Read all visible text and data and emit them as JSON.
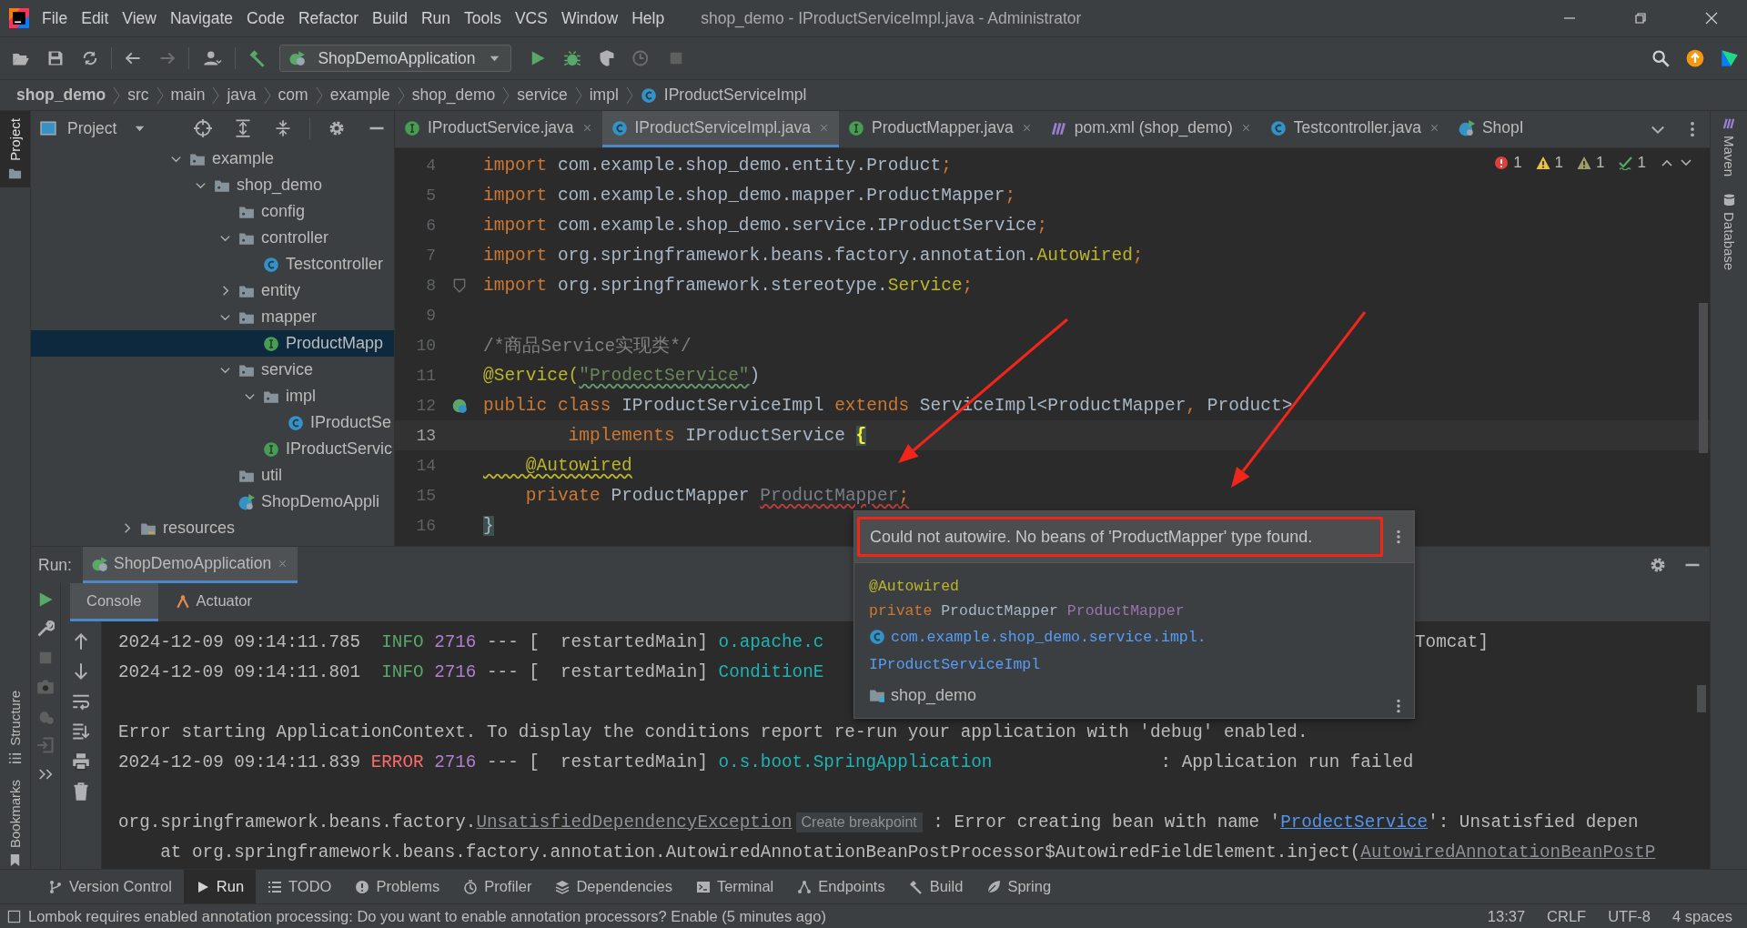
{
  "window": {
    "title": "shop_demo - IProductServiceImpl.java - Administrator"
  },
  "menu": [
    "File",
    "Edit",
    "View",
    "Navigate",
    "Code",
    "Refactor",
    "Build",
    "Run",
    "Tools",
    "VCS",
    "Window",
    "Help"
  ],
  "toolbar": {
    "run_config": "ShopDemoApplication"
  },
  "breadcrumbs": [
    {
      "label": "shop_demo",
      "kind": "project"
    },
    {
      "label": "src",
      "kind": "dir"
    },
    {
      "label": "main",
      "kind": "dir"
    },
    {
      "label": "java",
      "kind": "dir"
    },
    {
      "label": "com",
      "kind": "dir"
    },
    {
      "label": "example",
      "kind": "dir"
    },
    {
      "label": "shop_demo",
      "kind": "dir"
    },
    {
      "label": "service",
      "kind": "dir"
    },
    {
      "label": "impl",
      "kind": "dir"
    },
    {
      "label": "IProductServiceImpl",
      "kind": "class"
    }
  ],
  "left_strip": [
    {
      "label": "Project",
      "selected": true
    },
    {
      "label": "Structure",
      "selected": false
    },
    {
      "label": "Bookmarks",
      "selected": false
    }
  ],
  "right_strip": [
    {
      "label": "Maven",
      "kind": "maven"
    },
    {
      "label": "Database",
      "kind": "database"
    }
  ],
  "project": {
    "title": "Project",
    "tree": [
      {
        "children": [
          {
            "children": [
              {
                "label": "example",
                "kind": "folder",
                "expanded": true,
                "selected": false,
                "children": [
                  {
                    "label": "shop_demo",
                    "kind": "folder",
                    "expanded": true,
                    "selected": false,
                    "children": [
                      {
                        "label": "config",
                        "kind": "folder",
                        "selected": false
                      },
                      {
                        "label": "controller",
                        "kind": "folder",
                        "expanded": true,
                        "selected": false,
                        "children": [
                          {
                            "label": "Testcontroller",
                            "kind": "class",
                            "selected": false
                          }
                        ]
                      },
                      {
                        "label": "entity",
                        "kind": "folder",
                        "expanded": false,
                        "selected": false
                      },
                      {
                        "label": "mapper",
                        "kind": "folder",
                        "expanded": true,
                        "selected": false,
                        "children": [
                          {
                            "label": "ProductMapp",
                            "kind": "interface",
                            "selected": true
                          }
                        ]
                      },
                      {
                        "label": "service",
                        "kind": "folder",
                        "expanded": true,
                        "selected": false,
                        "children": [
                          {
                            "label": "impl",
                            "kind": "folder",
                            "expanded": true,
                            "selected": false,
                            "children": [
                              {
                                "label": "IProductSe",
                                "kind": "class",
                                "selected": false
                              }
                            ]
                          },
                          {
                            "label": "IProductServic",
                            "kind": "interface",
                            "selected": false
                          }
                        ]
                      },
                      {
                        "label": "util",
                        "kind": "folder",
                        "selected": false
                      },
                      {
                        "label": "ShopDemoAppli",
                        "kind": "app",
                        "selected": false
                      }
                    ]
                  }
                ]
              }
            ]
          }
        ]
      },
      {
        "label": "resources",
        "kind": "resources",
        "expanded": false,
        "selected": false
      }
    ]
  },
  "editor": {
    "tabs": [
      {
        "label": "IProductService.java",
        "kind": "interface",
        "selected": false
      },
      {
        "label": "IProductServiceImpl.java",
        "kind": "class",
        "selected": true
      },
      {
        "label": "ProductMapper.java",
        "kind": "interface",
        "selected": false
      },
      {
        "label": "pom.xml (shop_demo)",
        "kind": "maven",
        "selected": false
      },
      {
        "label": "Testcontroller.java",
        "kind": "class",
        "selected": false
      },
      {
        "label": "ShopI",
        "kind": "app",
        "selected": false
      }
    ],
    "inspections": {
      "errors": "1",
      "warnings": "1",
      "weak_warnings": "1",
      "typos": "1"
    },
    "lines": [
      {
        "number": "4",
        "current": false,
        "tokens": [
          {
            "text": "import ",
            "kind": "kw"
          },
          {
            "text": "com.example.shop_demo.entity.Product",
            "kind": "plain"
          },
          {
            "text": ";",
            "kind": "kw"
          }
        ]
      },
      {
        "number": "5",
        "current": false,
        "tokens": [
          {
            "text": "import ",
            "kind": "kw"
          },
          {
            "text": "com.example.shop_demo.mapper.ProductMapper",
            "kind": "plain"
          },
          {
            "text": ";",
            "kind": "kw"
          }
        ]
      },
      {
        "number": "6",
        "current": false,
        "tokens": [
          {
            "text": "import ",
            "kind": "kw"
          },
          {
            "text": "com.example.shop_demo.service.IProductService",
            "kind": "plain"
          },
          {
            "text": ";",
            "kind": "kw"
          }
        ]
      },
      {
        "number": "7",
        "current": false,
        "tokens": [
          {
            "text": "import ",
            "kind": "kw"
          },
          {
            "text": "org.springframework.beans.factory.annotation.",
            "kind": "plain"
          },
          {
            "text": "Autowired",
            "kind": "annotation"
          },
          {
            "text": ";",
            "kind": "kw"
          }
        ]
      },
      {
        "number": "8",
        "current": false,
        "kind": "fold",
        "tokens": [
          {
            "text": "import ",
            "kind": "kw"
          },
          {
            "text": "org.springframework.stereotype.",
            "kind": "plain"
          },
          {
            "text": "Service",
            "kind": "annotation"
          },
          {
            "text": ";",
            "kind": "kw"
          }
        ]
      },
      {
        "number": "9",
        "current": false
      },
      {
        "number": "10",
        "current": false,
        "tokens": [
          {
            "text": "/*商品Service实现类*/",
            "kind": "comment"
          }
        ]
      },
      {
        "number": "11",
        "current": false,
        "tokens": [
          {
            "text": "@Service(",
            "kind": "annotation"
          },
          {
            "text": "\"ProdectService\"",
            "kind": "string-typo"
          },
          {
            "text": ")",
            "kind": "plain"
          }
        ]
      },
      {
        "number": "12",
        "current": false,
        "kind": "bean",
        "tokens": [
          {
            "text": "public class ",
            "kind": "kw"
          },
          {
            "text": "IProductServiceImpl ",
            "kind": "plain"
          },
          {
            "text": "extends ",
            "kind": "kw"
          },
          {
            "text": "ServiceImpl<ProductMapper",
            "kind": "plain"
          },
          {
            "text": ",",
            "kind": "kw"
          },
          {
            "text": " Product>",
            "kind": "plain"
          }
        ]
      },
      {
        "number": "13",
        "current": true,
        "tokens": [
          {
            "text": "        implements ",
            "kind": "kw"
          },
          {
            "text": "IProductService ",
            "kind": "plain"
          },
          {
            "text": "{",
            "kind": "brace"
          }
        ]
      },
      {
        "number": "14",
        "current": false,
        "tokens": [
          {
            "text": "    @Autowired",
            "kind": "annotation-warn"
          }
        ]
      },
      {
        "number": "15",
        "current": false,
        "tokens": [
          {
            "text": "    private ",
            "kind": "kw"
          },
          {
            "text": "ProductMapper ",
            "kind": "plain"
          },
          {
            "text": "ProductMapper",
            "kind": "field-error"
          },
          {
            "text": ";",
            "kind": "kw-error"
          }
        ]
      },
      {
        "number": "16",
        "current": false,
        "tokens": [
          {
            "text": "}",
            "kind": "brace-block"
          }
        ]
      }
    ]
  },
  "popup": {
    "message": "Could not autowire. No beans of 'ProductMapper' type found.",
    "preview": [
      [
        {
          "text": "@Autowired",
          "kind": "annotation"
        }
      ],
      [
        {
          "text": "private ",
          "kind": "kw"
        },
        {
          "text": "ProductMapper ",
          "kind": "plain"
        },
        {
          "text": "ProductMapper",
          "kind": "field"
        }
      ]
    ],
    "package": "com.example.shop_demo.service.impl.",
    "class": "IProductServiceImpl",
    "module": "shop_demo"
  },
  "run": {
    "label": "Run:",
    "tabs": [
      {
        "label": "ShopDemoApplication",
        "selected": true
      }
    ],
    "subtabs": [
      {
        "label": "Console",
        "kind": "console",
        "selected": true
      },
      {
        "label": "Actuator",
        "kind": "actuator",
        "selected": false
      }
    ],
    "console": [
      {
        "kind": "log",
        "segments": [
          {
            "text": "2024-12-09 09:14:11.785  ",
            "kind": "plain"
          },
          {
            "text": "INFO",
            "kind": "info"
          },
          {
            "text": " 2716",
            "kind": "pid"
          },
          {
            "text": " --- [  restartedMain] ",
            "kind": "plain"
          },
          {
            "text": "o.apache.c",
            "kind": "logger"
          }
        ],
        "tail": "Tomcat]"
      },
      {
        "kind": "log",
        "segments": [
          {
            "text": "2024-12-09 09:14:11.801  ",
            "kind": "plain"
          },
          {
            "text": "INFO",
            "kind": "info"
          },
          {
            "text": " 2716",
            "kind": "pid"
          },
          {
            "text": " --- [  restartedMain] ",
            "kind": "plain"
          },
          {
            "text": "ConditionE",
            "kind": "logger"
          }
        ]
      },
      {
        "kind": "blank"
      },
      {
        "kind": "log",
        "segments": [
          {
            "text": "Error starting ApplicationContext. To display the conditions report re-run your application with 'debug' enabled.",
            "kind": "plain"
          }
        ]
      },
      {
        "kind": "log",
        "segments": [
          {
            "text": "2024-12-09 09:14:11.839 ",
            "kind": "plain"
          },
          {
            "text": "ERROR",
            "kind": "error"
          },
          {
            "text": " 2716",
            "kind": "pid"
          },
          {
            "text": " --- [  restartedMain] ",
            "kind": "plain"
          },
          {
            "text": "o.s.boot.SpringApplication",
            "kind": "logger"
          },
          {
            "text": "                : Application run failed",
            "kind": "plain"
          }
        ]
      },
      {
        "kind": "blank"
      },
      {
        "kind": "log",
        "segments": [
          {
            "text": "org.springframework.beans.factory.",
            "kind": "plain"
          },
          {
            "text": "UnsatisfiedDependencyException",
            "kind": "exception-link"
          },
          {
            "text": "Create breakpoint",
            "kind": "hint"
          },
          {
            "text": " : Error creating bean with name '",
            "kind": "plain"
          },
          {
            "text": "ProdectService",
            "kind": "link"
          },
          {
            "text": "': Unsatisfied depen",
            "kind": "plain"
          }
        ]
      },
      {
        "kind": "log",
        "segments": [
          {
            "text": "    at org.springframework.beans.factory.annotation.AutowiredAnnotationBeanPostProcessor$AutowiredFieldElement.inject(",
            "kind": "plain"
          },
          {
            "text": "AutowiredAnnotationBeanPostP",
            "kind": "exception-link"
          }
        ]
      }
    ]
  },
  "tool_tabs": [
    {
      "label": "Version Control",
      "kind": "vcs",
      "selected": false
    },
    {
      "label": "Run",
      "kind": "run",
      "selected": true
    },
    {
      "label": "TODO",
      "kind": "todo",
      "selected": false
    },
    {
      "label": "Problems",
      "kind": "problems",
      "selected": false
    },
    {
      "label": "Profiler",
      "kind": "profiler",
      "selected": false
    },
    {
      "label": "Dependencies",
      "kind": "dependencies",
      "selected": false
    },
    {
      "label": "Terminal",
      "kind": "terminal",
      "selected": false
    },
    {
      "label": "Endpoints",
      "kind": "endpoints",
      "selected": false
    },
    {
      "label": "Build",
      "kind": "build",
      "selected": false
    },
    {
      "label": "Spring",
      "kind": "spring",
      "selected": false
    }
  ],
  "status_bar": {
    "message": "Lombok requires enabled annotation processing: Do you want to enable annotation processors? Enable (5 minutes ago)",
    "items": [
      "13:37",
      "CRLF",
      "UTF-8",
      "4 spaces"
    ]
  }
}
